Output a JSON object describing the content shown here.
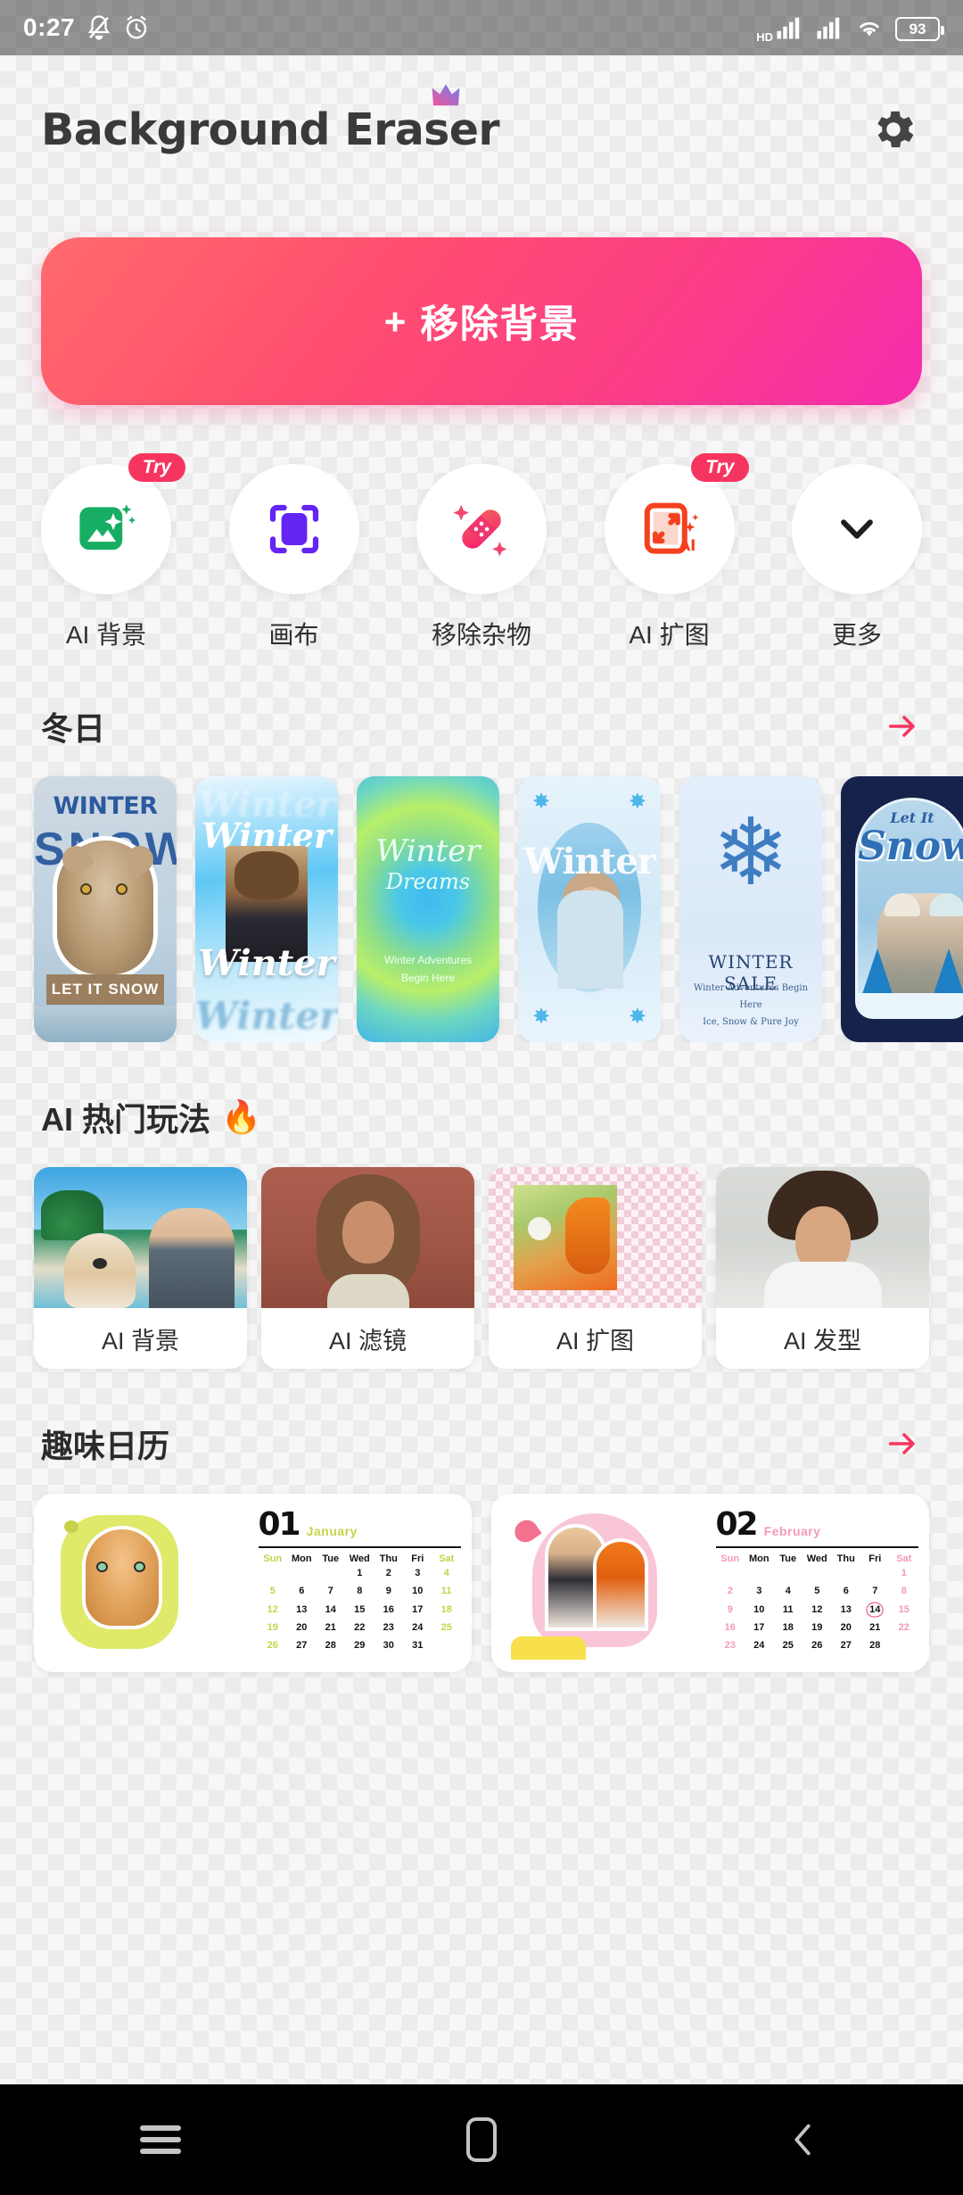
{
  "status_bar": {
    "time": "0:27",
    "icons_left": [
      "mute-bell-icon",
      "alarm-clock-icon"
    ],
    "network_label": "HD",
    "icons_right": [
      "signal-bars-icon",
      "signal-bars-2-icon",
      "wifi-icon"
    ],
    "battery_level": "93"
  },
  "header": {
    "app_title": "Background Eraser",
    "crown_icon": "crown-icon",
    "settings_icon": "gear-icon"
  },
  "cta": {
    "plus": "+",
    "label": "移除背景",
    "gradient_start": "#ff6b6b",
    "gradient_end": "#f62bae"
  },
  "tools": [
    {
      "label": "AI 背景",
      "icon": "ai-background-icon",
      "badge": "Try"
    },
    {
      "label": "画布",
      "icon": "canvas-crop-icon",
      "badge": ""
    },
    {
      "label": "移除杂物",
      "icon": "remove-object-bandage-icon",
      "badge": ""
    },
    {
      "label": "AI 扩图",
      "icon": "ai-expand-icon",
      "badge": "Try"
    },
    {
      "label": "更多",
      "icon": "chevron-down-icon",
      "badge": ""
    }
  ],
  "sections": {
    "winter": {
      "title": "冬日",
      "arrow_icon": "arrow-right-icon",
      "arrow_color": "#f5355f",
      "cards": [
        {
          "name": "winter-snow-cat",
          "line1": "WINTER",
          "line2": "SNOW",
          "caption": "LET IT SNOW"
        },
        {
          "name": "winter-script-portrait",
          "line1": "Winter",
          "line2": "Winter",
          "line3": "Winter",
          "line4": "Winter"
        },
        {
          "name": "winter-dreams-gradient",
          "line1": "Winter",
          "line2": "Dreams",
          "caption": "Winter Adventures Begin Here"
        },
        {
          "name": "winter-snowflake-portrait",
          "line1": "Winter"
        },
        {
          "name": "winter-sale-snowflake",
          "line1": "WINTER SALE",
          "caption": "Winter Adventures Begin Here",
          "caption2": "Ice, Snow & Pure Joy"
        },
        {
          "name": "let-it-snow-night-couple",
          "line1": "Let It",
          "line2": "Snow"
        }
      ]
    },
    "ai_popular": {
      "title": "AI 热门玩法",
      "emoji": "🔥",
      "cards": [
        {
          "label": "AI 背景",
          "thumb": "woman-with-corgi-beach-thumb"
        },
        {
          "label": "AI 滤镜",
          "thumb": "cartoon-woman-portrait-thumb"
        },
        {
          "label": "AI 扩图",
          "thumb": "girl-with-dandelion-transparent-thumb"
        },
        {
          "label": "AI 发型",
          "thumb": "man-with-dreadlocks-thumb"
        }
      ]
    },
    "calendar": {
      "title": "趣味日历",
      "arrow_icon": "arrow-right-icon",
      "cards": [
        {
          "name": "january-cat-calendar",
          "number": "01",
          "month": "January",
          "accent": "#c6d34a",
          "day_headers": [
            "Sun",
            "Mon",
            "Tue",
            "Wed",
            "Thu",
            "Fri",
            "Sat"
          ],
          "dates": [
            "",
            "",
            "",
            "1",
            "2",
            "3",
            "4",
            "5",
            "6",
            "7",
            "8",
            "9",
            "10",
            "11",
            "12",
            "13",
            "14",
            "15",
            "16",
            "17",
            "18",
            "19",
            "20",
            "21",
            "22",
            "23",
            "24",
            "25",
            "26",
            "27",
            "28",
            "29",
            "30",
            "31"
          ],
          "marked_date": ""
        },
        {
          "name": "february-couple-calendar",
          "number": "02",
          "month": "February",
          "accent": "#f49ab5",
          "day_headers": [
            "Sun",
            "Mon",
            "Tue",
            "Wed",
            "Thu",
            "Fri",
            "Sat"
          ],
          "dates": [
            "",
            "",
            "",
            "",
            "",
            "",
            "1",
            "2",
            "3",
            "4",
            "5",
            "6",
            "7",
            "8",
            "9",
            "10",
            "11",
            "12",
            "13",
            "14",
            "15",
            "16",
            "17",
            "18",
            "19",
            "20",
            "21",
            "22",
            "23",
            "24",
            "25",
            "26",
            "27",
            "28"
          ],
          "marked_date": "14"
        }
      ]
    }
  },
  "nav_bar": {
    "recents_icon": "hamburger-recents-icon",
    "home_icon": "home-icon",
    "back_icon": "back-chevron-icon"
  }
}
